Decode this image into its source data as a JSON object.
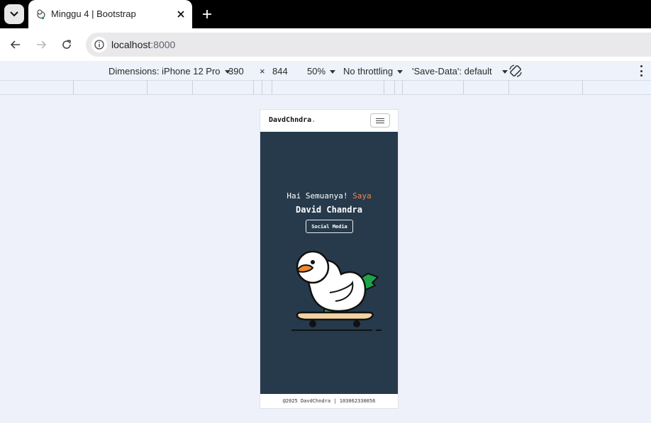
{
  "browser": {
    "tab": {
      "title": "Minggu 4 | Bootstrap",
      "favicon": "duck-favicon-icon"
    },
    "address": {
      "host": "localhost",
      "port": ":8000"
    }
  },
  "devtools": {
    "dimensions_label": "Dimensions: iPhone 12 Pro",
    "width": "390",
    "times": "×",
    "height": "844",
    "zoom": "50%",
    "throttling": "No throttling",
    "save_data": "'Save-Data': default"
  },
  "site": {
    "brand": "DavdChndra",
    "brand_dot": ".",
    "greeting": "Hai Semuanya!",
    "greeting_accent": "Saya",
    "name": "David Chandra",
    "social_button": "Social Media",
    "footer": "@2025 DavdChndra | 103062330056",
    "colors": {
      "hero_bg": "#263a4c",
      "accent": "#f5844c"
    },
    "illustration": "duck-skateboard-illustration"
  }
}
